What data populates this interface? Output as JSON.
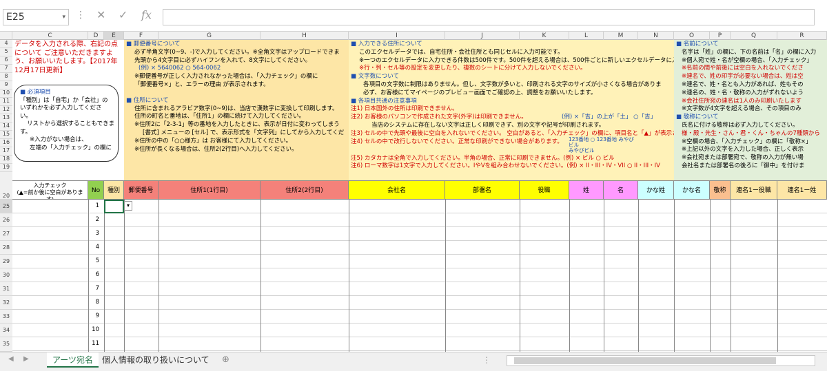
{
  "formula_bar": {
    "name_box": "E25",
    "fx": "fx"
  },
  "columns": [
    "C",
    "D",
    "E",
    "F",
    "G",
    "H",
    "I",
    "J",
    "K",
    "L",
    "M",
    "N",
    "O",
    "P",
    "Q",
    "R"
  ],
  "rows": [
    "4",
    "5",
    "6",
    "7",
    "8",
    "9",
    "10",
    "11",
    "12",
    "13",
    "14",
    "15",
    "16",
    "17",
    "18",
    "19",
    "20",
    "25",
    "26",
    "27",
    "28",
    "29",
    "30",
    "31",
    "32",
    "33",
    "34",
    "35"
  ],
  "notice": {
    "line1": "データを入力される際、右記の点",
    "line2": "について ご注意いただきますよ",
    "line3": "う、お願いいたします。【2017年",
    "line4": "12月17日更新】"
  },
  "callout": {
    "title": "■ 必須項目",
    "l1": "「種別」は「自宅」か「会社」の",
    "l2": "いずれかを必ず入力してくださ",
    "l3": "い。",
    "l4": "リストから選択することもできま",
    "l5": "す。",
    "l6": "※入力がない場合は、",
    "l7": "左端の「入力チェック」の欄に"
  },
  "postal": {
    "h": "■ 郵便番号について",
    "l1": "必ず半角文字(0~9、-)で入力してください。※全角文字はアップロードできま",
    "l2": "先頭から4文字目に必ずハイフンを入れて、8文字にしてください。",
    "l3": "(例) × 5640062  ○ 564-0062",
    "l4": "※郵便番号が正しく入力されなかった場合は、「入力チェック」の欄に",
    "l5": "「郵便番号×」と、エラーの理由 が表示されます。"
  },
  "address": {
    "h": "■ 住所について",
    "l1": "住所に含まれるアラビア数字(0~9)は、当店で漢数字に変換して印刷します。",
    "l2": "住所の町名と番地は、「住所1」の欄に続けて入力してください。",
    "l3": "※住所2に「2-3-1」等の番地を入力したときに、表示が日付に変わってしまう",
    "l4": "[書式] メニューの [セル] で、表示形式を「文字列」にしてから入力してくだ",
    "l5": "※住所の中の「○○様方」は お客様にて入力してください。",
    "l6": "※住所が長くなる場合は、住所2(2行目)へ入力してください。"
  },
  "input_addr": {
    "h": "■ 入力できる住所について",
    "l1": "このエクセルデータでは、自宅住所・会社住所とも同じセルに入力可能です。",
    "l2": "※一つのエクセルデータに入力できる件数は500件です。500件を超える場合は、500件ごとに新しいエクセルデータに入",
    "l3": "※行・列・セル等の設定を変更したり、複数のシートに分けて入力しないでください。",
    "h2": "■ 文字数について",
    "l4": "各項目の文字数に制限はありません。但し、文字数が多いと、印刷される文字のサイズが小さくなる場合がありま",
    "l5": "必ず、お客様にてマイページのプレビュー画面でご確認の上、調整をお願いいたします。",
    "h3": "■ 各項目共通の注意事項",
    "n1": "注1) 日本国外の住所は印刷できません。",
    "n2": "注2) お客様のパソコンで作成された文字(外字)は印刷できません。",
    "n2b": "(例) ×「吉」の上が「土」 ○「吉」",
    "n2c": "当店のシステムに存在しない文字は正しく印刷できず、別の文字や記号が印刷されます。",
    "n3": "注3) セルの中で先頭や最後に空白を入れないでください。 空白があると、「入力チェック」の欄に、項目名と「▲」が表示さ",
    "n4": "注4) セルの中で改行しないでください。正常な印刷ができない場合があります。",
    "n4b": "123番地 ○ 123番地 みやび",
    "n4c": "ビル",
    "n4d": "みやびビル",
    "n5": "注5) カタカナは全角で入力してください。半角の場合、正常に印刷できません。(例) × ビル  ○ ビル",
    "n6": "注6) ローマ数字は1文字で入力してください。IやVを組み合わせないでください。(例) × II・III・IV・VII ○ II・III・IV"
  },
  "names": {
    "h": "■ 名前について",
    "l1": "名字は「姓」の欄に、下の名前は「名」の欄に入力",
    "l2": "※個人宛で姓・名が空欄の場合、「入力チェック」",
    "l3": "※名前の間や前後には空白を入れないでくださ",
    "l4": "※連名で、姓の印字が必要ない場合は、姓は空",
    "l5": "※連名で、姓・名とも入力があれば、姓もその",
    "l6": "※連名の、姓・名・敬称の入力がずれないよう",
    "l7": "※会社住所宛の連名は1人のみ印刷いたします",
    "l8": "※文字数が4文字を超える場合、その項目のみ",
    "h2": "■ 敬称について",
    "l9": "氏名に付ける敬称は必ず入力してください。",
    "l10": "様・殿・先生・さん・君・くん・ちゃんの7種類から",
    "l11": "※空欄の場合、「入力チェック」の欄に「敬称×」",
    "l12": "※上記以外の文字を入力した場合、正しく表示",
    "l13": "※会社宛または部署宛で、敬称の入力が無い場",
    "l14": "会社名または部署名の後ろに「御中」を付けま"
  },
  "headers": {
    "check": "入力チェック",
    "check2": "(▲=前か後に空白がありま",
    "check3": "す)",
    "no": "No",
    "kind": "種別",
    "postal": "郵便番号",
    "addr1": "住所1(1行目)",
    "addr2": "住所2(2行目)",
    "company": "会社名",
    "dept": "部署名",
    "title": "役職",
    "sei": "姓",
    "mei": "名",
    "kana_sei": "かな姓",
    "kana_mei": "かな名",
    "honorific": "敬称",
    "joint_title": "連名1ー役職",
    "joint_sei": "連名1ー姓"
  },
  "numbers": [
    "1",
    "2",
    "3",
    "4",
    "5",
    "6",
    "7",
    "8",
    "9",
    "10",
    "11"
  ],
  "tabs": {
    "active": "アーツ宛名",
    "other": "個人情報の取り扱いについて"
  }
}
